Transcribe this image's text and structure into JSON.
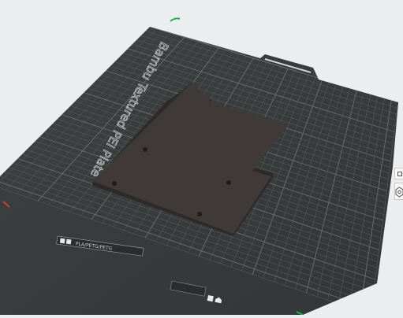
{
  "plate": {
    "brand_text": "Bambu Textured PEI Plate",
    "filament_label": "PLA/PETG/PETG",
    "plate_index": "1"
  },
  "colors": {
    "background": "#ecedee",
    "plate": "#3b3e3f",
    "grid": "#5b5f60",
    "grid_major": "#6a6e6f",
    "part": "#3f3a38",
    "axis_green": "#1fb15a",
    "axis_red": "#d43b3b"
  },
  "icons": {
    "side_top": "rect-icon",
    "side_bottom": "hexagon-settings-icon",
    "plate_toolbar": [
      "lock-icon",
      "arrange-icon"
    ],
    "bottom_toolbar": [
      "square-icon",
      "home-icon"
    ]
  }
}
